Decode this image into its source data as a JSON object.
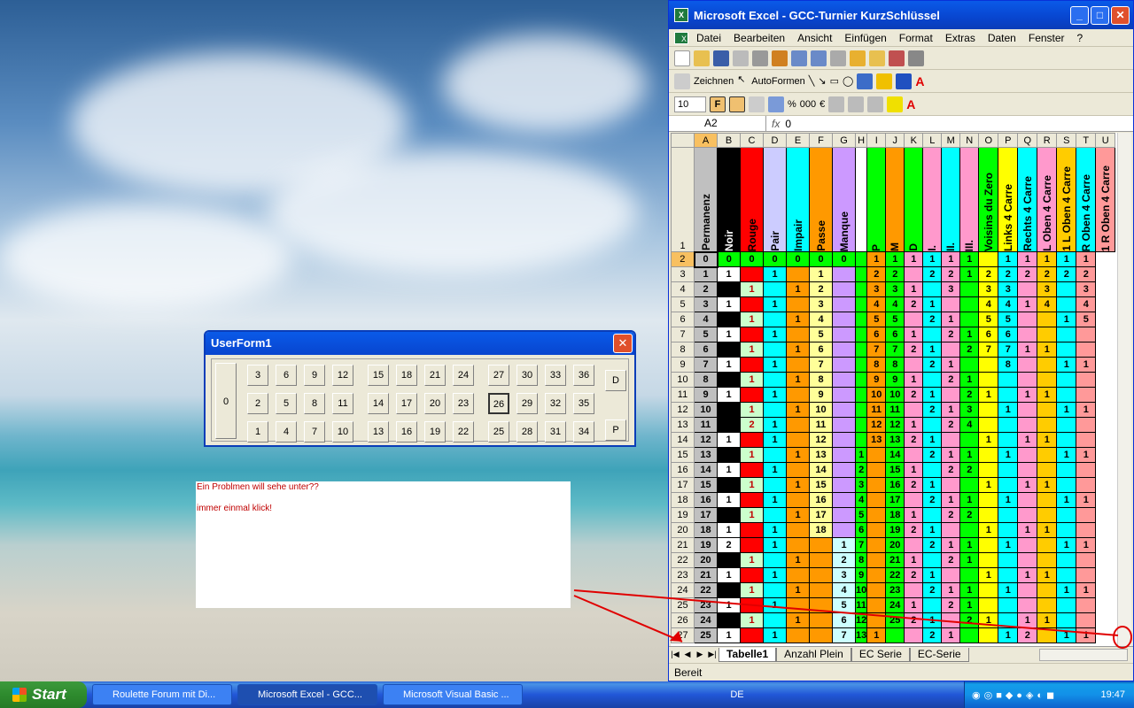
{
  "window": {
    "title": "Microsoft Excel - GCC-Turnier KurzSchlüssel"
  },
  "menu": [
    "Datei",
    "Bearbeiten",
    "Ansicht",
    "Einfügen",
    "Format",
    "Extras",
    "Daten",
    "Fenster",
    "?"
  ],
  "toolbar": {
    "zeichnen": "Zeichnen",
    "autoformen": "AutoFormen",
    "fontsize": "10",
    "bold": "F"
  },
  "formula": {
    "cell": "A2",
    "fx": "fx",
    "value": "0"
  },
  "columns": [
    "A",
    "B",
    "C",
    "D",
    "E",
    "F",
    "G",
    "H",
    "I",
    "J",
    "K",
    "L",
    "M",
    "N",
    "O",
    "P",
    "Q",
    "R",
    "S",
    "T",
    "U"
  ],
  "headers": [
    "Permanenz",
    "Noir",
    "Rouge",
    "Pair",
    "Impair",
    "Passe",
    "Manque",
    "",
    "P",
    "M",
    "D",
    "I.",
    "II.",
    "III.",
    "Voisins du Zero",
    "Links 4 Carre",
    "Rechts 4 Carre",
    "L Oben 4 Carre",
    "1 L Oben 4 Carre",
    "R Oben 4 Carre",
    "1 R Oben 4 Carre"
  ],
  "rows": [
    [
      "2",
      "0",
      "0",
      "0",
      "0",
      "0",
      "0",
      "0",
      "",
      "1",
      "1",
      "1",
      "1",
      "1",
      "1",
      "",
      "1",
      "1",
      "1",
      "1",
      "1"
    ],
    [
      "3",
      "1",
      "1",
      "",
      "1",
      "",
      "1",
      "",
      "",
      "2",
      "2",
      "",
      "2",
      "2",
      "1",
      "2",
      "2",
      "2",
      "2",
      "2",
      "2"
    ],
    [
      "4",
      "2",
      "",
      "1",
      "",
      "1",
      "2",
      "",
      "",
      "3",
      "3",
      "1",
      "",
      "3",
      "",
      "3",
      "3",
      "",
      "3",
      "",
      "3"
    ],
    [
      "5",
      "3",
      "1",
      "",
      "1",
      "",
      "3",
      "",
      "",
      "4",
      "4",
      "2",
      "1",
      "",
      "",
      "4",
      "4",
      "1",
      "4",
      "",
      "4"
    ],
    [
      "6",
      "4",
      "",
      "1",
      "",
      "1",
      "4",
      "",
      "",
      "5",
      "5",
      "",
      "2",
      "1",
      "",
      "5",
      "5",
      "",
      "",
      "1",
      "5"
    ],
    [
      "7",
      "5",
      "1",
      "",
      "1",
      "",
      "5",
      "",
      "",
      "6",
      "6",
      "1",
      "",
      "2",
      "1",
      "6",
      "6",
      "",
      "",
      "",
      ""
    ],
    [
      "8",
      "6",
      "",
      "1",
      "",
      "1",
      "6",
      "",
      "",
      "7",
      "7",
      "2",
      "1",
      "",
      "2",
      "7",
      "7",
      "1",
      "1",
      "",
      ""
    ],
    [
      "9",
      "7",
      "1",
      "",
      "1",
      "",
      "7",
      "",
      "",
      "8",
      "8",
      "",
      "2",
      "1",
      "",
      "",
      "8",
      "",
      "",
      "1",
      "1"
    ],
    [
      "10",
      "8",
      "",
      "1",
      "",
      "1",
      "8",
      "",
      "",
      "9",
      "9",
      "1",
      "",
      "2",
      "1",
      "",
      "",
      "",
      "",
      "",
      ""
    ],
    [
      "11",
      "9",
      "1",
      "",
      "1",
      "",
      "9",
      "",
      "",
      "10",
      "10",
      "2",
      "1",
      "",
      "2",
      "1",
      "",
      "1",
      "1",
      "",
      ""
    ],
    [
      "12",
      "10",
      "",
      "1",
      "",
      "1",
      "10",
      "",
      "",
      "11",
      "11",
      "",
      "2",
      "1",
      "3",
      "",
      "1",
      "",
      "",
      "1",
      "1"
    ],
    [
      "13",
      "11",
      "",
      "2",
      "1",
      "",
      "11",
      "",
      "",
      "12",
      "12",
      "1",
      "",
      "2",
      "4",
      "",
      "",
      "",
      "",
      "",
      ""
    ],
    [
      "14",
      "12",
      "1",
      "",
      "1",
      "",
      "12",
      "",
      "",
      "13",
      "13",
      "2",
      "1",
      "",
      "",
      "1",
      "",
      "1",
      "1",
      "",
      ""
    ],
    [
      "15",
      "13",
      "",
      "1",
      "",
      "1",
      "13",
      "",
      "1",
      "",
      "14",
      "",
      "2",
      "1",
      "1",
      "",
      "1",
      "",
      "",
      "1",
      "1"
    ],
    [
      "16",
      "14",
      "1",
      "",
      "1",
      "",
      "14",
      "",
      "2",
      "",
      "15",
      "1",
      "",
      "2",
      "2",
      "",
      "",
      "",
      "",
      "",
      ""
    ],
    [
      "17",
      "15",
      "",
      "1",
      "",
      "1",
      "15",
      "",
      "3",
      "",
      "16",
      "2",
      "1",
      "",
      "",
      "1",
      "",
      "1",
      "1",
      "",
      ""
    ],
    [
      "18",
      "16",
      "1",
      "",
      "1",
      "",
      "16",
      "",
      "4",
      "",
      "17",
      "",
      "2",
      "1",
      "1",
      "",
      "1",
      "",
      "",
      "1",
      "1"
    ],
    [
      "19",
      "17",
      "",
      "1",
      "",
      "1",
      "17",
      "",
      "5",
      "",
      "18",
      "1",
      "",
      "2",
      "2",
      "",
      "",
      "",
      "",
      "",
      ""
    ],
    [
      "20",
      "18",
      "1",
      "",
      "1",
      "",
      "18",
      "",
      "6",
      "",
      "19",
      "2",
      "1",
      "",
      "",
      "1",
      "",
      "1",
      "1",
      "",
      ""
    ],
    [
      "21",
      "19",
      "2",
      "",
      "1",
      "",
      "",
      "1",
      "7",
      "",
      "20",
      "",
      "2",
      "1",
      "1",
      "",
      "1",
      "",
      "",
      "1",
      "1"
    ],
    [
      "22",
      "20",
      "",
      "1",
      "",
      "1",
      "",
      "2",
      "8",
      "",
      "21",
      "1",
      "",
      "2",
      "1",
      "",
      "",
      "",
      "",
      "",
      ""
    ],
    [
      "23",
      "21",
      "1",
      "",
      "1",
      "",
      "",
      "3",
      "9",
      "",
      "22",
      "2",
      "1",
      "",
      "",
      "1",
      "",
      "1",
      "1",
      "",
      ""
    ],
    [
      "24",
      "22",
      "",
      "1",
      "",
      "1",
      "",
      "4",
      "10",
      "",
      "23",
      "",
      "2",
      "1",
      "1",
      "",
      "1",
      "",
      "",
      "1",
      "1"
    ],
    [
      "25",
      "23",
      "1",
      "",
      "1",
      "",
      "",
      "5",
      "11",
      "",
      "24",
      "1",
      "",
      "2",
      "1",
      "",
      "",
      "",
      "",
      "",
      ""
    ],
    [
      "26",
      "24",
      "",
      "1",
      "",
      "1",
      "",
      "6",
      "12",
      "",
      "25",
      "2",
      "1",
      "",
      "2",
      "1",
      "",
      "1",
      "1",
      "",
      ""
    ],
    [
      "27",
      "25",
      "1",
      "",
      "1",
      "",
      "",
      "7",
      "13",
      "1",
      "",
      "",
      "2",
      "1",
      "",
      "",
      "1",
      "2",
      "",
      "1",
      "1"
    ]
  ],
  "userform": {
    "title": "UserForm1",
    "zero": "0",
    "row1": [
      "3",
      "6",
      "9",
      "12",
      "15",
      "18",
      "21",
      "24",
      "27",
      "30",
      "33",
      "36"
    ],
    "row2": [
      "2",
      "5",
      "8",
      "11",
      "14",
      "17",
      "20",
      "23",
      "26",
      "29",
      "32",
      "35"
    ],
    "row3": [
      "1",
      "4",
      "7",
      "10",
      "13",
      "16",
      "19",
      "22",
      "25",
      "28",
      "31",
      "34"
    ],
    "btn_d": "D",
    "btn_p": "P"
  },
  "note": {
    "line1": "Ein Problmen will sehe unter??",
    "line2": "immer einmal klick!"
  },
  "sheets": [
    "Tabelle1",
    "Anzahl Plein",
    "EC Serie",
    "EC-Serie"
  ],
  "status": "Bereit",
  "taskbar": {
    "start": "Start",
    "tasks": [
      "Roulette Forum mit Di...",
      "Microsoft Excel - GCC...",
      "Microsoft Visual Basic ..."
    ],
    "lang": "DE",
    "time": "19:47"
  }
}
